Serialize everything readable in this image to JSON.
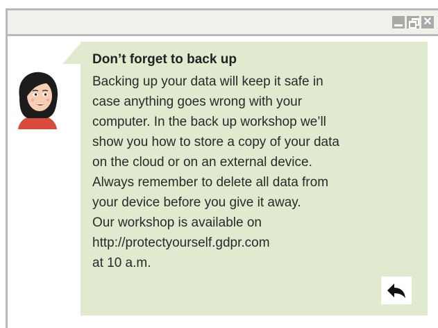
{
  "window": {
    "controls": {
      "minimize": "minimize-icon",
      "restore": "restore-icon",
      "close_label": "✕"
    }
  },
  "message": {
    "title": "Don’t forget to back up",
    "lines": [
      "Backing up your data will keep it safe in",
      "case anything goes wrong with your",
      "computer. In the back up workshop we’ll",
      "show you how to store a copy of your data",
      "on the cloud or on an external device.",
      "Always remember to delete all data from",
      "your device before you give it away.",
      "Our workshop is available on",
      "http://protectyourself.gdpr.com",
      "at 10 a.m."
    ]
  },
  "reply": {
    "icon": "reply-arrow-icon"
  },
  "colors": {
    "bubble": "#dfeacf",
    "titlebar": "#f1f0ea",
    "window_border": "#b9b9b9",
    "control_buttons": "#a9a9a9"
  }
}
